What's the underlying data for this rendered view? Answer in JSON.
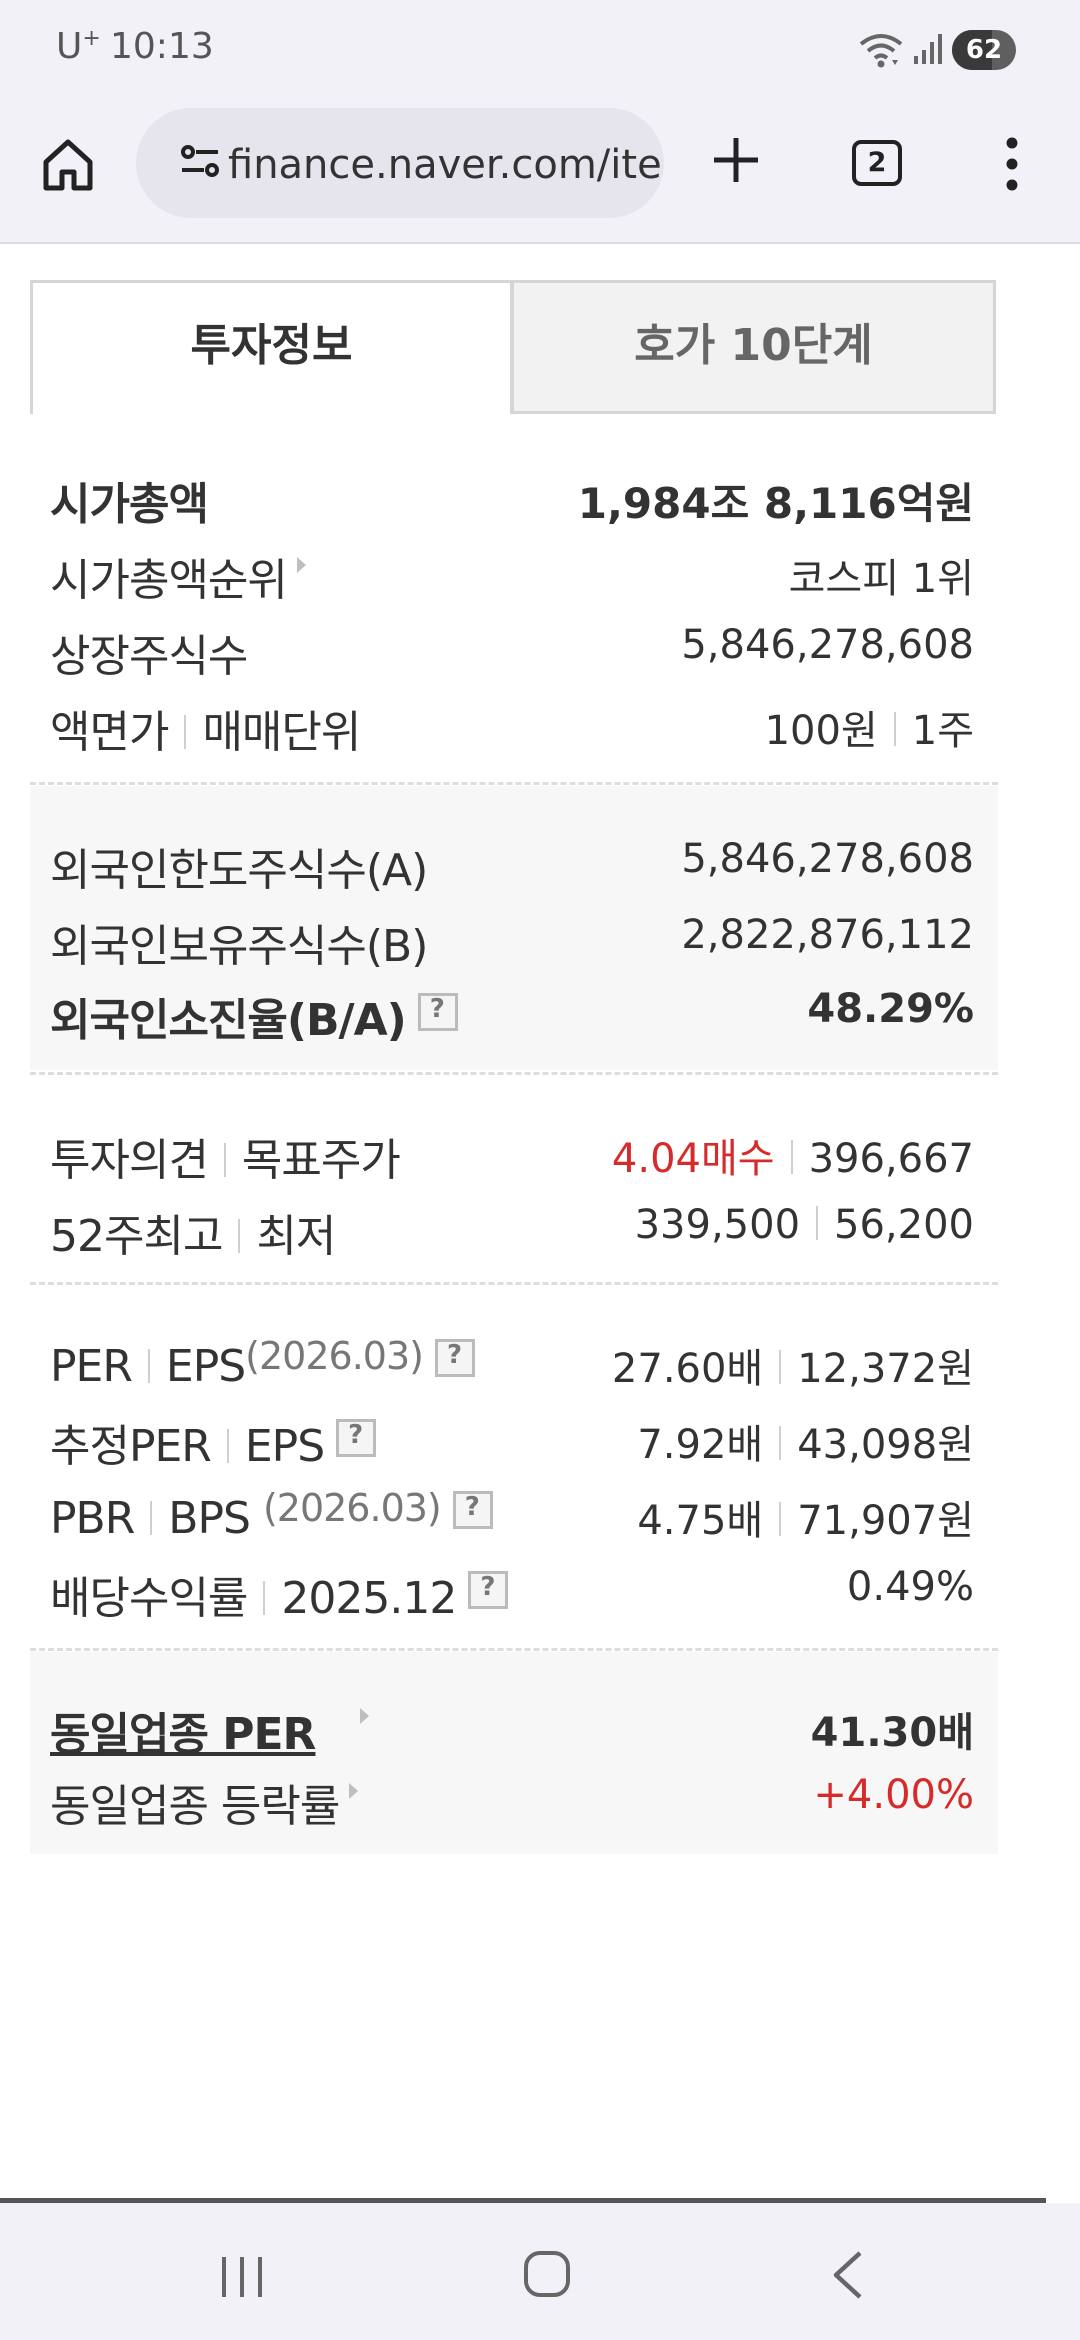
{
  "status_bar": {
    "carrier": "U",
    "carrier_sup": "+",
    "time": "10:13",
    "battery": "62",
    "battery_level": 0.62
  },
  "browser": {
    "url": "finance.naver.com/ite",
    "tab_count": "2"
  },
  "tabs": [
    {
      "label": "투자정보",
      "active": true
    },
    {
      "label": "호가 10단계",
      "active": false
    }
  ],
  "info": {
    "market_cap": {
      "label": "시가총액",
      "value": "1,984조 8,116억원"
    },
    "market_cap_rank": {
      "label": "시가총액순위",
      "value": "코스피 1위"
    },
    "listed_shares": {
      "label": "상장주식수",
      "value": "5,846,278,608"
    },
    "par_value": {
      "label": "액면가",
      "label2": "매매단위",
      "value": "100원",
      "value2": "1주"
    },
    "foreign_limit": {
      "label": "외국인한도주식수(A)",
      "value": "5,846,278,608"
    },
    "foreign_held": {
      "label": "외국인보유주식수(B)",
      "value": "2,822,876,112"
    },
    "foreign_ratio": {
      "label": "외국인소진율(B/A)",
      "value": "48.29%"
    },
    "opinion": {
      "label": "투자의견",
      "label2": "목표주가",
      "value": "4.04매수",
      "value2": "396,667"
    },
    "week52": {
      "label": "52주최고",
      "label2": "최저",
      "value": "339,500",
      "value2": "56,200"
    },
    "per": {
      "label": "PER",
      "label2": "EPS",
      "sub": "(2026.03)",
      "value": "27.60배",
      "value2": "12,372원"
    },
    "est_per": {
      "label": "추정PER",
      "label2": "EPS",
      "value": "7.92배",
      "value2": "43,098원"
    },
    "pbr": {
      "label": "PBR",
      "label2": "BPS",
      "sub": "(2026.03)",
      "value": "4.75배",
      "value2": "71,907원"
    },
    "dividend": {
      "label": "배당수익률",
      "label2": "2025.12",
      "value": "0.49%"
    },
    "sector_per": {
      "label": "동일업종 PER",
      "value": "41.30배"
    },
    "sector_change": {
      "label": "동일업종 등락률",
      "value": "+4.00%"
    }
  },
  "colors": {
    "up": "#d62b2b",
    "text": "#333333",
    "section_bg": "#f7f7f7"
  }
}
